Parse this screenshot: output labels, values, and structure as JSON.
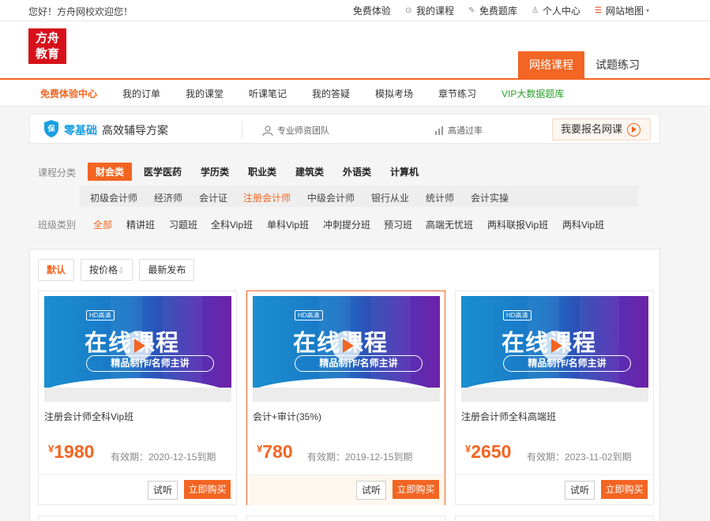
{
  "topbar": {
    "welcome": "您好！方舟网校欢迎您！",
    "links": [
      {
        "label": "免费体验",
        "icon": ""
      },
      {
        "label": "我的课程",
        "icon": "play-circle-icon"
      },
      {
        "label": "免费题库",
        "icon": "pencil-icon"
      },
      {
        "label": "个人中心",
        "icon": "user-icon"
      },
      {
        "label": "网站地图",
        "icon": "list-icon"
      }
    ]
  },
  "logo": {
    "line1": "方舟",
    "line2": "教育"
  },
  "main_nav": [
    {
      "label": "网络课程",
      "active": true
    },
    {
      "label": "试题练习",
      "active": false
    }
  ],
  "sub_nav": [
    {
      "label": "免费体验中心"
    },
    {
      "label": "我的订单"
    },
    {
      "label": "我的课堂"
    },
    {
      "label": "听课笔记"
    },
    {
      "label": "我的答疑"
    },
    {
      "label": "模拟考场"
    },
    {
      "label": "章节练习"
    },
    {
      "label": "VIP大数据题库"
    }
  ],
  "banner": {
    "highlight": "零基础",
    "title": "高效辅导方案",
    "feature1": "专业师资团队",
    "feature2": "高通过率",
    "signup": "我要报名网课"
  },
  "filters": {
    "category_label": "课程分类",
    "categories": [
      "财会类",
      "医学医药",
      "学历类",
      "职业类",
      "建筑类",
      "外语类",
      "计算机"
    ],
    "subcategories": [
      "初级会计师",
      "经济师",
      "会计证",
      "注册会计师",
      "中级会计师",
      "银行从业",
      "统计师",
      "会计实操"
    ],
    "class_label": "班级类别",
    "classes": [
      "全部",
      "精讲班",
      "习题班",
      "全科Vip班",
      "单科Vip班",
      "冲刺提分班",
      "预习班",
      "高端无忧班",
      "两科联报Vip班",
      "两科Vip班"
    ]
  },
  "sort": {
    "default": "默认",
    "by_price": "按价格",
    "price_arrow": "⇩",
    "latest": "最新发布"
  },
  "thumb": {
    "hd": "HD高清",
    "title": "在线课程",
    "subtitle": "精品制作/名师主讲"
  },
  "courses": [
    {
      "name": "注册会计师全科Vip班",
      "currency": "¥",
      "price": "1980",
      "valid": "有效期：2020-12-15到期",
      "trial": "试听",
      "buy": "立即购买"
    },
    {
      "name": "会计+审计(35%)",
      "currency": "¥",
      "price": "780",
      "valid": "有效期：2019-12-15到期",
      "trial": "试听",
      "buy": "立即购买"
    },
    {
      "name": "注册会计师全科高端班",
      "currency": "¥",
      "price": "2650",
      "valid": "有效期：2023-11-02到期",
      "trial": "试听",
      "buy": "立即购买"
    }
  ],
  "colors": {
    "accent": "#f26522",
    "brand_red": "#d6111a",
    "blue": "#1a9fe0",
    "green": "#2aa02a"
  }
}
